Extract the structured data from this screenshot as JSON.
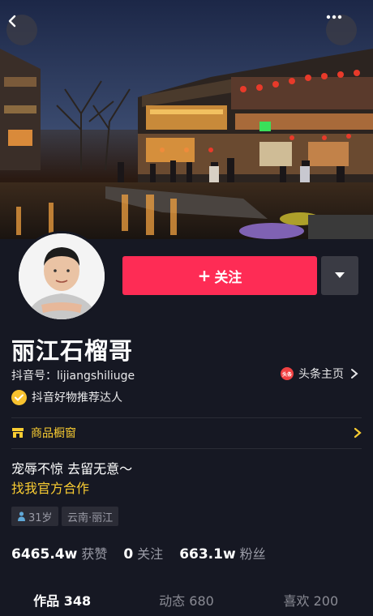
{
  "header": {
    "back_icon": "chevron-left-icon",
    "more_icon": "ellipsis-icon"
  },
  "profile": {
    "name": "丽江石榴哥",
    "douyin_id": "抖音号：lijiangshiliuge",
    "toutiao_badge": "头条",
    "toutiao_link": "头条主页",
    "verified_text": "抖音好物推荐达人",
    "follow_label": "关注",
    "follow_plus": "+"
  },
  "shop": {
    "label": "商品橱窗"
  },
  "bio": {
    "line1": "宠辱不惊 去留无意～",
    "line2": "找我官方合作"
  },
  "tags": {
    "age": "31岁",
    "location": "云南·丽江"
  },
  "stats": [
    {
      "value": "6465.4w",
      "label": "获赞"
    },
    {
      "value": "0",
      "label": "关注"
    },
    {
      "value": "663.1w",
      "label": "粉丝"
    }
  ],
  "tabs": [
    {
      "label": "作品 348",
      "active": true
    },
    {
      "label": "动态 680",
      "active": false
    },
    {
      "label": "喜欢 200",
      "active": false
    }
  ],
  "colors": {
    "background": "#161823",
    "follow": "#fe2c55",
    "accent_yellow": "#facd32"
  }
}
